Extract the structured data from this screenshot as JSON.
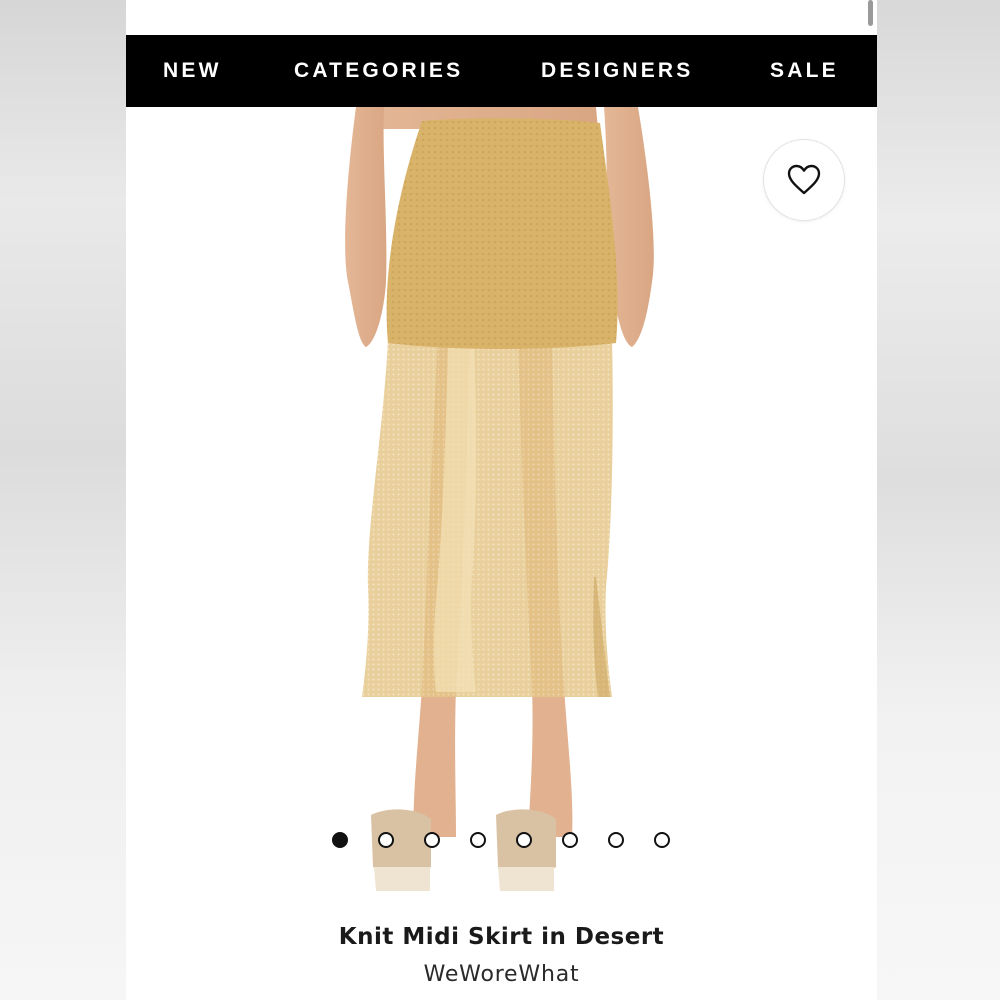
{
  "nav": {
    "items": [
      {
        "label": "NEW"
      },
      {
        "label": "CATEGORIES"
      },
      {
        "label": "DESIGNERS"
      },
      {
        "label": "SALE"
      }
    ]
  },
  "product": {
    "title": "Knit Midi Skirt in Desert",
    "brand": "WeWoreWhat",
    "image_icon": "knit-midi-skirt-photo",
    "skirt_color": "#dcb76d",
    "favorite_icon": "heart-outline-icon"
  },
  "carousel": {
    "total": 8,
    "active_index": 0
  }
}
